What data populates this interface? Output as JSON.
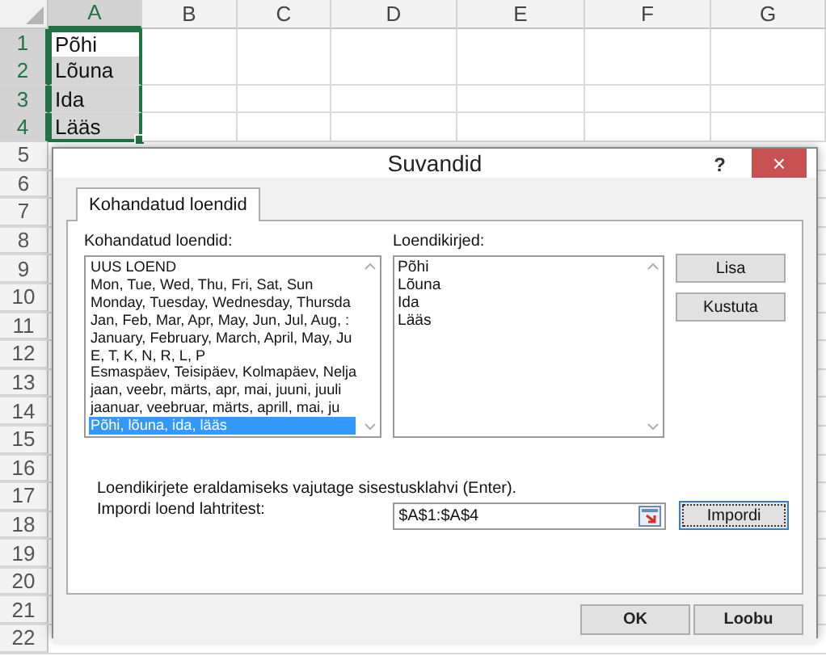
{
  "spreadsheet": {
    "columns": [
      {
        "label": "A",
        "selected": true
      },
      {
        "label": "B",
        "selected": false
      },
      {
        "label": "C",
        "selected": false
      },
      {
        "label": "D",
        "selected": false
      },
      {
        "label": "E",
        "selected": false
      },
      {
        "label": "F",
        "selected": false
      },
      {
        "label": "G",
        "selected": false
      }
    ],
    "rows": [
      {
        "number": "1",
        "selected": true,
        "cells": [
          {
            "value": "Põhi",
            "selected": false
          }
        ]
      },
      {
        "number": "2",
        "selected": true,
        "cells": [
          {
            "value": "Lõuna",
            "selected": true
          }
        ]
      },
      {
        "number": "3",
        "selected": true,
        "cells": [
          {
            "value": "Ida",
            "selected": true
          }
        ]
      },
      {
        "number": "4",
        "selected": true,
        "cells": [
          {
            "value": "Lääs",
            "selected": true
          }
        ]
      },
      {
        "number": "5",
        "selected": false
      },
      {
        "number": "6",
        "selected": false
      },
      {
        "number": "7",
        "selected": false
      },
      {
        "number": "8",
        "selected": false
      },
      {
        "number": "9",
        "selected": false
      },
      {
        "number": "10",
        "selected": false
      },
      {
        "number": "11",
        "selected": false
      },
      {
        "number": "12",
        "selected": false
      },
      {
        "number": "13",
        "selected": false
      },
      {
        "number": "14",
        "selected": false
      },
      {
        "number": "15",
        "selected": false
      },
      {
        "number": "16",
        "selected": false
      },
      {
        "number": "17",
        "selected": false
      },
      {
        "number": "18",
        "selected": false
      },
      {
        "number": "19",
        "selected": false
      },
      {
        "number": "20",
        "selected": false
      },
      {
        "number": "21",
        "selected": false
      },
      {
        "number": "22",
        "selected": false
      }
    ]
  },
  "dialog": {
    "title": "Suvandid",
    "help": "?",
    "close": "×",
    "tabs": [
      {
        "label": "Kohandatud loendid",
        "selected": true
      }
    ],
    "custom_lists": {
      "label": "Kohandatud loendid:",
      "items": [
        {
          "text": "UUS LOEND",
          "selected": false
        },
        {
          "text": "Mon, Tue, Wed, Thu, Fri, Sat, Sun",
          "selected": false
        },
        {
          "text": "Monday, Tuesday, Wednesday, Thursda",
          "selected": false
        },
        {
          "text": "Jan, Feb, Mar, Apr, May, Jun, Jul, Aug, :",
          "selected": false
        },
        {
          "text": "January, February, March, April, May, Ju",
          "selected": false
        },
        {
          "text": "E, T, K, N, R, L, P",
          "selected": false
        },
        {
          "text": "Esmaspäev, Teisipäev, Kolmapäev, Nelja",
          "selected": false
        },
        {
          "text": "jaan, veebr, märts, apr, mai, juuni, juuli",
          "selected": false
        },
        {
          "text": "jaanuar, veebruar, märts, aprill, mai, ju",
          "selected": false
        },
        {
          "text": "Põhi, lõuna, ida, lääs",
          "selected": true
        }
      ]
    },
    "list_entries": {
      "label": "Loendikirjed:",
      "lines": [
        "Põhi",
        "Lõuna",
        "Ida",
        "Lääs"
      ]
    },
    "side_buttons": [
      "Lisa",
      "Kustuta"
    ],
    "hint": "Loendikirjete eraldamiseks vajutage sisestusklahvi (Enter).",
    "import": {
      "label": "Impordi loend lahtritest:",
      "value": "$A$1:$A$4",
      "button": "Impordi"
    },
    "footer_buttons": [
      "OK",
      "Loobu"
    ]
  }
}
